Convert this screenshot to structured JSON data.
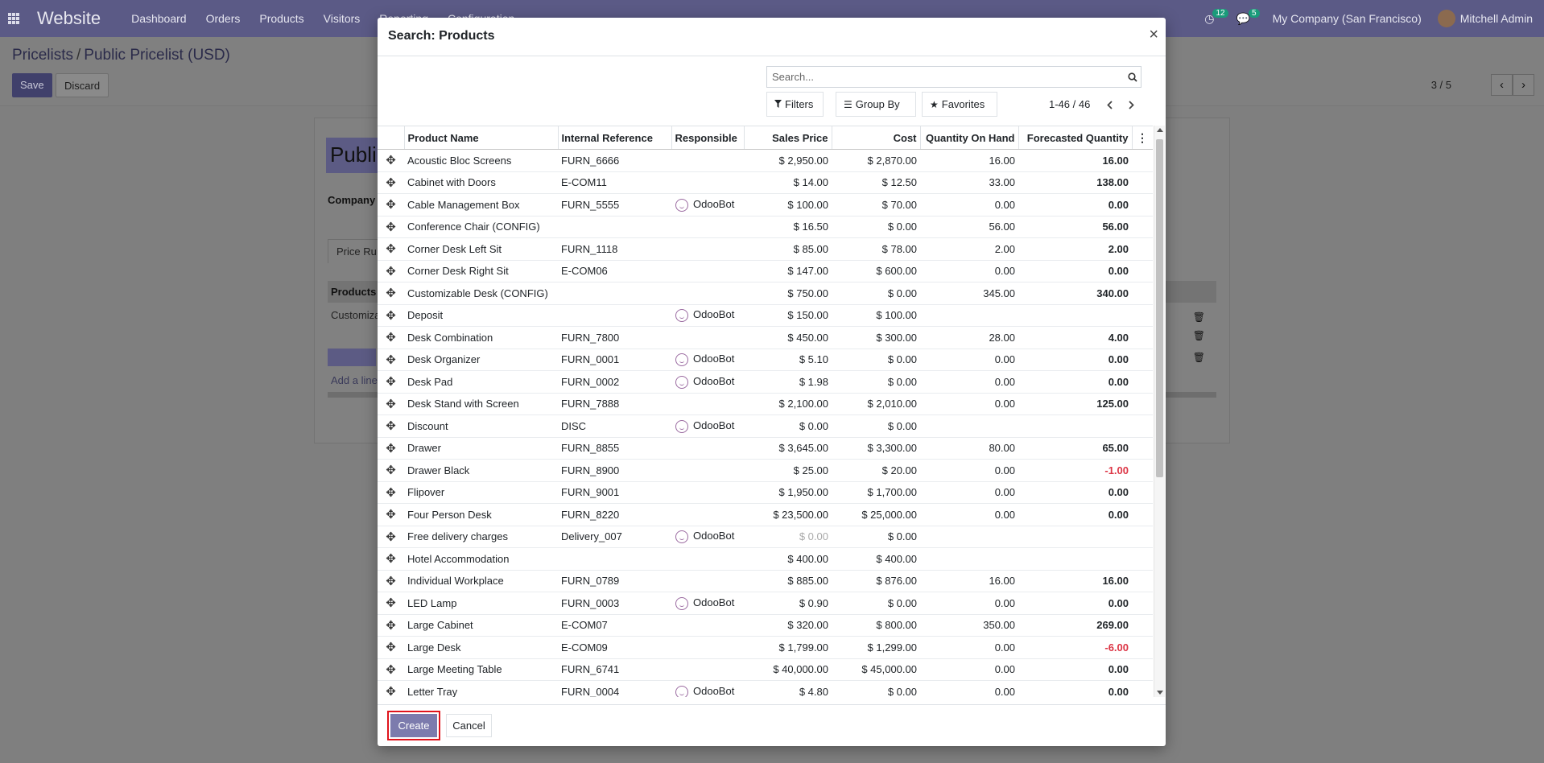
{
  "navbar": {
    "app_name": "Website",
    "menu": [
      "Dashboard",
      "Orders",
      "Products",
      "Visitors",
      "Reporting",
      "Configuration"
    ],
    "activity_count": "12",
    "messages_count": "5",
    "company": "My Company (San Francisco)",
    "user": "Mitchell Admin"
  },
  "control_panel": {
    "breadcrumb_parent": "Pricelists",
    "breadcrumb_current": "Public Pricelist (USD)",
    "save_label": "Save",
    "discard_label": "Discard",
    "pager": "3 / 5"
  },
  "form": {
    "title_partial": "Publi",
    "company_label": "Company",
    "tab_label": "Price Ru",
    "table_header": "Products",
    "row_text": "Customiza",
    "add_line": "Add a line"
  },
  "modal": {
    "title": "Search: Products",
    "close": "×",
    "search_placeholder": "Search...",
    "filters_label": "Filters",
    "groupby_label": "Group By",
    "favorites_label": "Favorites",
    "pager_text": "1-46 / 46",
    "columns": [
      "Product Name",
      "Internal Reference",
      "Responsible",
      "Sales Price",
      "Cost",
      "Quantity On Hand",
      "Forecasted Quantity"
    ],
    "rows": [
      {
        "name": "Acoustic Bloc Screens",
        "ref": "FURN_6666",
        "resp": "",
        "price": "$ 2,950.00",
        "cost": "$ 2,870.00",
        "qoh": "16.00",
        "fq": "16.00"
      },
      {
        "name": "Cabinet with Doors",
        "ref": "E-COM11",
        "resp": "",
        "price": "$ 14.00",
        "cost": "$ 12.50",
        "qoh": "33.00",
        "fq": "138.00"
      },
      {
        "name": "Cable Management Box",
        "ref": "FURN_5555",
        "resp": "OdooBot",
        "price": "$ 100.00",
        "cost": "$ 70.00",
        "qoh": "0.00",
        "fq": "0.00"
      },
      {
        "name": "Conference Chair (CONFIG)",
        "ref": "",
        "resp": "",
        "price": "$ 16.50",
        "cost": "$ 0.00",
        "qoh": "56.00",
        "fq": "56.00"
      },
      {
        "name": "Corner Desk Left Sit",
        "ref": "FURN_1118",
        "resp": "",
        "price": "$ 85.00",
        "cost": "$ 78.00",
        "qoh": "2.00",
        "fq": "2.00"
      },
      {
        "name": "Corner Desk Right Sit",
        "ref": "E-COM06",
        "resp": "",
        "price": "$ 147.00",
        "cost": "$ 600.00",
        "qoh": "0.00",
        "fq": "0.00"
      },
      {
        "name": "Customizable Desk (CONFIG)",
        "ref": "",
        "resp": "",
        "price": "$ 750.00",
        "cost": "$ 0.00",
        "qoh": "345.00",
        "fq": "340.00"
      },
      {
        "name": "Deposit",
        "ref": "",
        "resp": "OdooBot",
        "price": "$ 150.00",
        "cost": "$ 100.00",
        "qoh": "",
        "fq": ""
      },
      {
        "name": "Desk Combination",
        "ref": "FURN_7800",
        "resp": "",
        "price": "$ 450.00",
        "cost": "$ 300.00",
        "qoh": "28.00",
        "fq": "4.00"
      },
      {
        "name": "Desk Organizer",
        "ref": "FURN_0001",
        "resp": "OdooBot",
        "price": "$ 5.10",
        "cost": "$ 0.00",
        "qoh": "0.00",
        "fq": "0.00"
      },
      {
        "name": "Desk Pad",
        "ref": "FURN_0002",
        "resp": "OdooBot",
        "price": "$ 1.98",
        "cost": "$ 0.00",
        "qoh": "0.00",
        "fq": "0.00"
      },
      {
        "name": "Desk Stand with Screen",
        "ref": "FURN_7888",
        "resp": "",
        "price": "$ 2,100.00",
        "cost": "$ 2,010.00",
        "qoh": "0.00",
        "fq": "125.00"
      },
      {
        "name": "Discount",
        "ref": "DISC",
        "resp": "OdooBot",
        "price": "$ 0.00",
        "cost": "$ 0.00",
        "qoh": "",
        "fq": ""
      },
      {
        "name": "Drawer",
        "ref": "FURN_8855",
        "resp": "",
        "price": "$ 3,645.00",
        "cost": "$ 3,300.00",
        "qoh": "80.00",
        "fq": "65.00"
      },
      {
        "name": "Drawer Black",
        "ref": "FURN_8900",
        "resp": "",
        "price": "$ 25.00",
        "cost": "$ 20.00",
        "qoh": "0.00",
        "fq": "-1.00",
        "fq_neg": true
      },
      {
        "name": "Flipover",
        "ref": "FURN_9001",
        "resp": "",
        "price": "$ 1,950.00",
        "cost": "$ 1,700.00",
        "qoh": "0.00",
        "fq": "0.00"
      },
      {
        "name": "Four Person Desk",
        "ref": "FURN_8220",
        "resp": "",
        "price": "$ 23,500.00",
        "cost": "$ 25,000.00",
        "qoh": "0.00",
        "fq": "0.00"
      },
      {
        "name": "Free delivery charges",
        "ref": "Delivery_007",
        "resp": "OdooBot",
        "price": "$ 0.00",
        "price_muted": true,
        "cost": "$ 0.00",
        "qoh": "",
        "fq": ""
      },
      {
        "name": "Hotel Accommodation",
        "ref": "",
        "resp": "",
        "price": "$ 400.00",
        "cost": "$ 400.00",
        "qoh": "",
        "fq": ""
      },
      {
        "name": "Individual Workplace",
        "ref": "FURN_0789",
        "resp": "",
        "price": "$ 885.00",
        "cost": "$ 876.00",
        "qoh": "16.00",
        "fq": "16.00"
      },
      {
        "name": "LED Lamp",
        "ref": "FURN_0003",
        "resp": "OdooBot",
        "price": "$ 0.90",
        "cost": "$ 0.00",
        "qoh": "0.00",
        "fq": "0.00"
      },
      {
        "name": "Large Cabinet",
        "ref": "E-COM07",
        "resp": "",
        "price": "$ 320.00",
        "cost": "$ 800.00",
        "qoh": "350.00",
        "fq": "269.00"
      },
      {
        "name": "Large Desk",
        "ref": "E-COM09",
        "resp": "",
        "price": "$ 1,799.00",
        "cost": "$ 1,299.00",
        "qoh": "0.00",
        "fq": "-6.00",
        "fq_neg": true
      },
      {
        "name": "Large Meeting Table",
        "ref": "FURN_6741",
        "resp": "",
        "price": "$ 40,000.00",
        "cost": "$ 45,000.00",
        "qoh": "0.00",
        "fq": "0.00"
      },
      {
        "name": "Letter Tray",
        "ref": "FURN_0004",
        "resp": "OdooBot",
        "price": "$ 4.80",
        "cost": "$ 0.00",
        "qoh": "0.00",
        "fq": "0.00"
      }
    ],
    "create_label": "Create",
    "cancel_label": "Cancel"
  }
}
